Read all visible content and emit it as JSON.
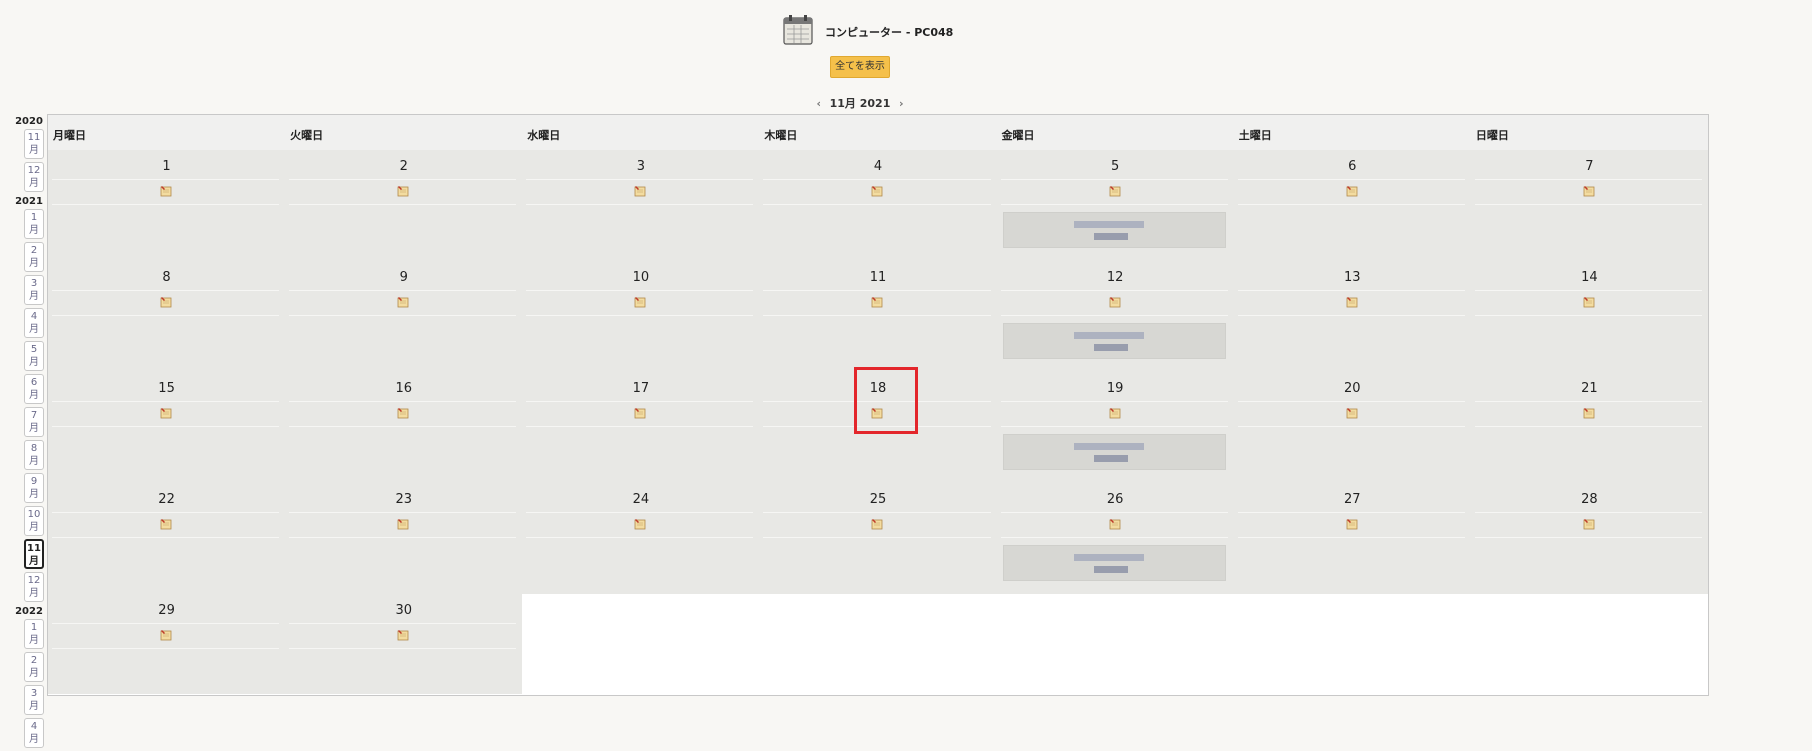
{
  "header": {
    "icon": "calendar-app-icon",
    "title": "コンピューター - PC048",
    "show_all_label": "全てを表示"
  },
  "month_nav": {
    "prev_icon": "chevron-left-icon",
    "label": "11月 2021",
    "next_icon": "chevron-right-icon"
  },
  "sidebar": [
    {
      "year": "2020",
      "months": [
        "11",
        "12"
      ]
    },
    {
      "year": "2021",
      "months": [
        "1",
        "2",
        "3",
        "4",
        "5",
        "6",
        "7",
        "8",
        "9",
        "10",
        "11",
        "12"
      ]
    },
    {
      "year": "2022",
      "months": [
        "1",
        "2",
        "3",
        "4"
      ]
    }
  ],
  "month_suffix": "月",
  "active_month": "2021-11",
  "day_headers": [
    "月曜日",
    "火曜日",
    "水曜日",
    "木曜日",
    "金曜日",
    "土曜日",
    "日曜日"
  ],
  "weeks": [
    [
      "1",
      "2",
      "3",
      "4",
      "5",
      "6",
      "7"
    ],
    [
      "8",
      "9",
      "10",
      "11",
      "12",
      "13",
      "14"
    ],
    [
      "15",
      "16",
      "17",
      "18",
      "19",
      "20",
      "21"
    ],
    [
      "22",
      "23",
      "24",
      "25",
      "26",
      "27",
      "28"
    ],
    [
      "29",
      "30",
      "",
      "",
      "",
      "",
      ""
    ]
  ],
  "event_days": [
    "5",
    "12",
    "19",
    "26"
  ],
  "note_icon": "note-pencil-icon",
  "highlighted_day": "18",
  "colors": {
    "accent": "#f5c04a",
    "highlight": "#e3262b",
    "cell_bg": "#e8e8e5"
  }
}
